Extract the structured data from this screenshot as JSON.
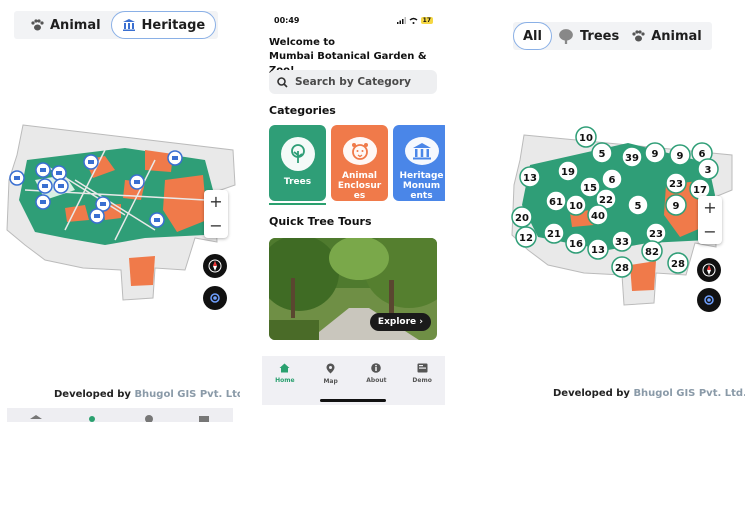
{
  "left_screen": {
    "filter_chips": [
      {
        "label": "Animal",
        "icon": "paw-icon",
        "selected": false
      },
      {
        "label": "Heritage",
        "icon": "bank-icon",
        "selected": true
      }
    ],
    "zoom_in": "+",
    "zoom_out": "−",
    "developed_by": "Developed by",
    "company": "Bhugol GIS Pvt. Ltd."
  },
  "mid_screen": {
    "time": "00:49",
    "battery": "17",
    "welcome_line1": "Welcome to",
    "welcome_line2": "Mumbai Botanical Garden & Zoo!",
    "search_placeholder": "Search by Category",
    "categories_title": "Categories",
    "categories": [
      {
        "label": "Trees",
        "color": "#2f9e77",
        "icon": "tree-icon"
      },
      {
        "label": "Animal\nEnclosur\nes",
        "color": "#f07a4a",
        "icon": "tiger-icon"
      },
      {
        "label": "Heritage\nMonum\nents",
        "color": "#4a86e8",
        "icon": "bank-icon"
      }
    ],
    "tours_title": "Quick Tree Tours",
    "explore_label": "Explore",
    "tabs": [
      {
        "label": "Home",
        "icon": "home-icon",
        "active": true
      },
      {
        "label": "Map",
        "icon": "map-pin-icon",
        "active": false
      },
      {
        "label": "About",
        "icon": "info-icon",
        "active": false
      },
      {
        "label": "Demo",
        "icon": "demo-icon",
        "active": false
      }
    ]
  },
  "right_screen": {
    "filter_chips": [
      {
        "label": "All",
        "icon": "",
        "selected": true
      },
      {
        "label": "Trees",
        "icon": "tree-icon",
        "selected": false
      },
      {
        "label": "Animal",
        "icon": "paw-icon",
        "selected": false
      }
    ],
    "cluster_counts": [
      "10",
      "5",
      "39",
      "9",
      "9",
      "6",
      "13",
      "19",
      "15",
      "6",
      "3",
      "23",
      "17",
      "61",
      "10",
      "22",
      "40",
      "5",
      "9",
      "20",
      "12",
      "21",
      "16",
      "33",
      "23",
      "13",
      "28",
      "82",
      "28"
    ],
    "zoom_in": "+",
    "zoom_out": "−",
    "developed_by": "Developed by",
    "company": "Bhugol GIS Pvt. Ltd."
  },
  "colors": {
    "accent_green": "#2aa06f",
    "orange": "#f07a4a",
    "blue": "#4a86e8",
    "map_green": "#2f9e77"
  }
}
